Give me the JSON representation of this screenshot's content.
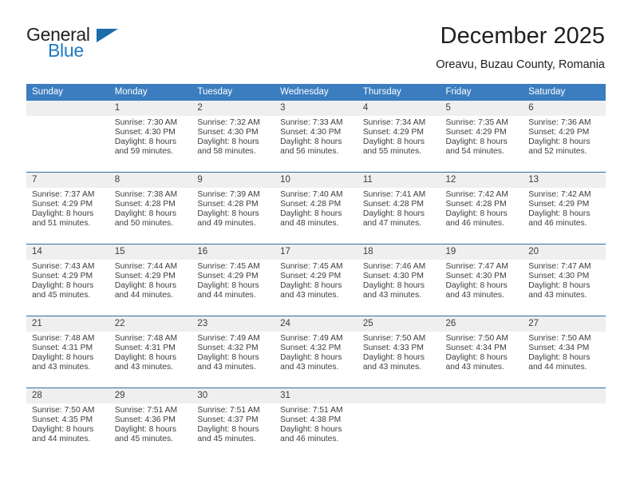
{
  "brand": {
    "name_part1": "General",
    "name_part2": "Blue",
    "logo_icon": "triangle-icon",
    "accent_color": "#1f7ac4"
  },
  "header": {
    "title": "December 2025",
    "location": "Oreavu, Buzau County, Romania"
  },
  "calendar": {
    "header_bg": "#3b7dbf",
    "row_border_color": "#2e6da4",
    "daynum_bg": "#efefef",
    "weekday_headers": [
      "Sunday",
      "Monday",
      "Tuesday",
      "Wednesday",
      "Thursday",
      "Friday",
      "Saturday"
    ],
    "weeks": [
      [
        {
          "day": "",
          "sunrise": "",
          "sunset": "",
          "daylight_line1": "",
          "daylight_line2": "",
          "empty": true
        },
        {
          "day": "1",
          "sunrise": "Sunrise: 7:30 AM",
          "sunset": "Sunset: 4:30 PM",
          "daylight_line1": "Daylight: 8 hours",
          "daylight_line2": "and 59 minutes."
        },
        {
          "day": "2",
          "sunrise": "Sunrise: 7:32 AM",
          "sunset": "Sunset: 4:30 PM",
          "daylight_line1": "Daylight: 8 hours",
          "daylight_line2": "and 58 minutes."
        },
        {
          "day": "3",
          "sunrise": "Sunrise: 7:33 AM",
          "sunset": "Sunset: 4:30 PM",
          "daylight_line1": "Daylight: 8 hours",
          "daylight_line2": "and 56 minutes."
        },
        {
          "day": "4",
          "sunrise": "Sunrise: 7:34 AM",
          "sunset": "Sunset: 4:29 PM",
          "daylight_line1": "Daylight: 8 hours",
          "daylight_line2": "and 55 minutes."
        },
        {
          "day": "5",
          "sunrise": "Sunrise: 7:35 AM",
          "sunset": "Sunset: 4:29 PM",
          "daylight_line1": "Daylight: 8 hours",
          "daylight_line2": "and 54 minutes."
        },
        {
          "day": "6",
          "sunrise": "Sunrise: 7:36 AM",
          "sunset": "Sunset: 4:29 PM",
          "daylight_line1": "Daylight: 8 hours",
          "daylight_line2": "and 52 minutes."
        }
      ],
      [
        {
          "day": "7",
          "sunrise": "Sunrise: 7:37 AM",
          "sunset": "Sunset: 4:29 PM",
          "daylight_line1": "Daylight: 8 hours",
          "daylight_line2": "and 51 minutes."
        },
        {
          "day": "8",
          "sunrise": "Sunrise: 7:38 AM",
          "sunset": "Sunset: 4:28 PM",
          "daylight_line1": "Daylight: 8 hours",
          "daylight_line2": "and 50 minutes."
        },
        {
          "day": "9",
          "sunrise": "Sunrise: 7:39 AM",
          "sunset": "Sunset: 4:28 PM",
          "daylight_line1": "Daylight: 8 hours",
          "daylight_line2": "and 49 minutes."
        },
        {
          "day": "10",
          "sunrise": "Sunrise: 7:40 AM",
          "sunset": "Sunset: 4:28 PM",
          "daylight_line1": "Daylight: 8 hours",
          "daylight_line2": "and 48 minutes."
        },
        {
          "day": "11",
          "sunrise": "Sunrise: 7:41 AM",
          "sunset": "Sunset: 4:28 PM",
          "daylight_line1": "Daylight: 8 hours",
          "daylight_line2": "and 47 minutes."
        },
        {
          "day": "12",
          "sunrise": "Sunrise: 7:42 AM",
          "sunset": "Sunset: 4:28 PM",
          "daylight_line1": "Daylight: 8 hours",
          "daylight_line2": "and 46 minutes."
        },
        {
          "day": "13",
          "sunrise": "Sunrise: 7:42 AM",
          "sunset": "Sunset: 4:29 PM",
          "daylight_line1": "Daylight: 8 hours",
          "daylight_line2": "and 46 minutes."
        }
      ],
      [
        {
          "day": "14",
          "sunrise": "Sunrise: 7:43 AM",
          "sunset": "Sunset: 4:29 PM",
          "daylight_line1": "Daylight: 8 hours",
          "daylight_line2": "and 45 minutes."
        },
        {
          "day": "15",
          "sunrise": "Sunrise: 7:44 AM",
          "sunset": "Sunset: 4:29 PM",
          "daylight_line1": "Daylight: 8 hours",
          "daylight_line2": "and 44 minutes."
        },
        {
          "day": "16",
          "sunrise": "Sunrise: 7:45 AM",
          "sunset": "Sunset: 4:29 PM",
          "daylight_line1": "Daylight: 8 hours",
          "daylight_line2": "and 44 minutes."
        },
        {
          "day": "17",
          "sunrise": "Sunrise: 7:45 AM",
          "sunset": "Sunset: 4:29 PM",
          "daylight_line1": "Daylight: 8 hours",
          "daylight_line2": "and 43 minutes."
        },
        {
          "day": "18",
          "sunrise": "Sunrise: 7:46 AM",
          "sunset": "Sunset: 4:30 PM",
          "daylight_line1": "Daylight: 8 hours",
          "daylight_line2": "and 43 minutes."
        },
        {
          "day": "19",
          "sunrise": "Sunrise: 7:47 AM",
          "sunset": "Sunset: 4:30 PM",
          "daylight_line1": "Daylight: 8 hours",
          "daylight_line2": "and 43 minutes."
        },
        {
          "day": "20",
          "sunrise": "Sunrise: 7:47 AM",
          "sunset": "Sunset: 4:30 PM",
          "daylight_line1": "Daylight: 8 hours",
          "daylight_line2": "and 43 minutes."
        }
      ],
      [
        {
          "day": "21",
          "sunrise": "Sunrise: 7:48 AM",
          "sunset": "Sunset: 4:31 PM",
          "daylight_line1": "Daylight: 8 hours",
          "daylight_line2": "and 43 minutes."
        },
        {
          "day": "22",
          "sunrise": "Sunrise: 7:48 AM",
          "sunset": "Sunset: 4:31 PM",
          "daylight_line1": "Daylight: 8 hours",
          "daylight_line2": "and 43 minutes."
        },
        {
          "day": "23",
          "sunrise": "Sunrise: 7:49 AM",
          "sunset": "Sunset: 4:32 PM",
          "daylight_line1": "Daylight: 8 hours",
          "daylight_line2": "and 43 minutes."
        },
        {
          "day": "24",
          "sunrise": "Sunrise: 7:49 AM",
          "sunset": "Sunset: 4:32 PM",
          "daylight_line1": "Daylight: 8 hours",
          "daylight_line2": "and 43 minutes."
        },
        {
          "day": "25",
          "sunrise": "Sunrise: 7:50 AM",
          "sunset": "Sunset: 4:33 PM",
          "daylight_line1": "Daylight: 8 hours",
          "daylight_line2": "and 43 minutes."
        },
        {
          "day": "26",
          "sunrise": "Sunrise: 7:50 AM",
          "sunset": "Sunset: 4:34 PM",
          "daylight_line1": "Daylight: 8 hours",
          "daylight_line2": "and 43 minutes."
        },
        {
          "day": "27",
          "sunrise": "Sunrise: 7:50 AM",
          "sunset": "Sunset: 4:34 PM",
          "daylight_line1": "Daylight: 8 hours",
          "daylight_line2": "and 44 minutes."
        }
      ],
      [
        {
          "day": "28",
          "sunrise": "Sunrise: 7:50 AM",
          "sunset": "Sunset: 4:35 PM",
          "daylight_line1": "Daylight: 8 hours",
          "daylight_line2": "and 44 minutes."
        },
        {
          "day": "29",
          "sunrise": "Sunrise: 7:51 AM",
          "sunset": "Sunset: 4:36 PM",
          "daylight_line1": "Daylight: 8 hours",
          "daylight_line2": "and 45 minutes."
        },
        {
          "day": "30",
          "sunrise": "Sunrise: 7:51 AM",
          "sunset": "Sunset: 4:37 PM",
          "daylight_line1": "Daylight: 8 hours",
          "daylight_line2": "and 45 minutes."
        },
        {
          "day": "31",
          "sunrise": "Sunrise: 7:51 AM",
          "sunset": "Sunset: 4:38 PM",
          "daylight_line1": "Daylight: 8 hours",
          "daylight_line2": "and 46 minutes."
        },
        {
          "day": "",
          "sunrise": "",
          "sunset": "",
          "daylight_line1": "",
          "daylight_line2": "",
          "empty": true
        },
        {
          "day": "",
          "sunrise": "",
          "sunset": "",
          "daylight_line1": "",
          "daylight_line2": "",
          "empty": true
        },
        {
          "day": "",
          "sunrise": "",
          "sunset": "",
          "daylight_line1": "",
          "daylight_line2": "",
          "empty": true
        }
      ]
    ]
  }
}
